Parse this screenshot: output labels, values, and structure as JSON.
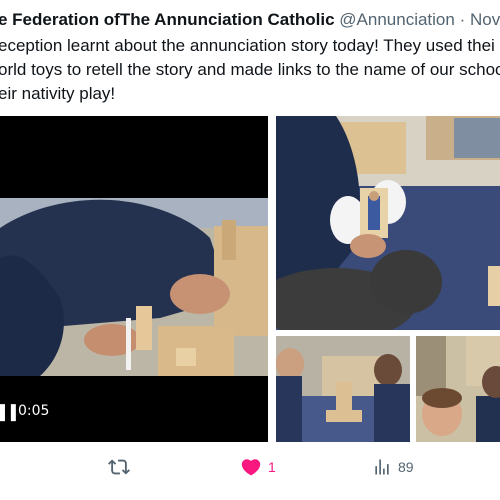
{
  "tweet": {
    "author_name": "e Federation ofThe Annunciation Catholic",
    "handle": "@Annunciation",
    "separator": "·",
    "date": "Nov",
    "text_lines": [
      "eception learnt about the annunciation story today! They used thei",
      "orld toys to retell the story and made links to the name of our schoo",
      "eir nativity play!"
    ]
  },
  "video": {
    "timestamp": "0:05",
    "pause_icon": "pause-icon"
  },
  "actions": {
    "retweet_icon": "retweet-icon",
    "like_icon": "heart-icon",
    "like_count": "1",
    "views_icon": "views-chart-icon",
    "views_count": "89"
  },
  "colors": {
    "like": "#f91880",
    "secondary_text": "#536471",
    "primary_text": "#0f1419"
  }
}
